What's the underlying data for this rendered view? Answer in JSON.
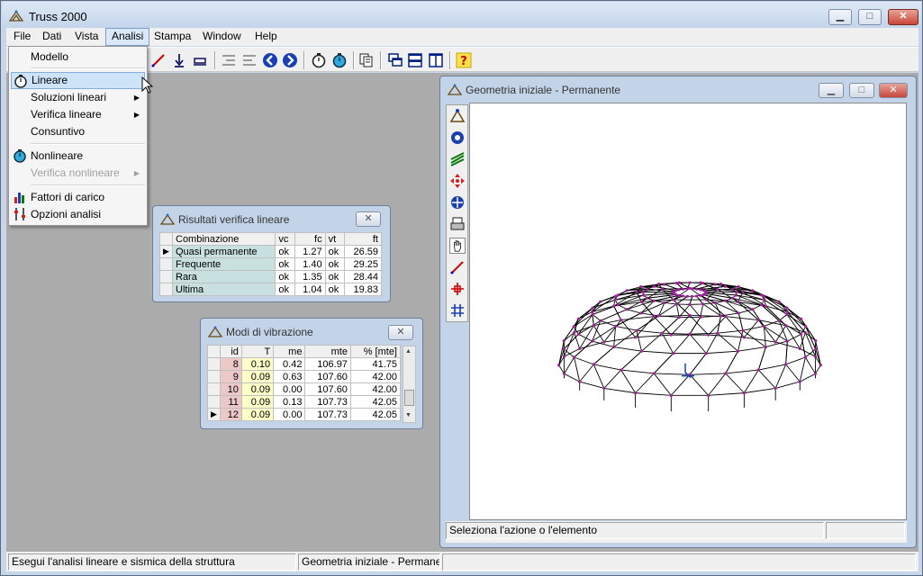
{
  "window": {
    "title": "Truss 2000",
    "min": "▁",
    "max": "□",
    "close": "✕"
  },
  "menu": [
    "File",
    "Dati",
    "Vista",
    "Analisi",
    "Stampa",
    "Window",
    "Help"
  ],
  "dropdown": {
    "items": [
      {
        "label": "Modello"
      },
      {
        "label": "Lineare"
      },
      {
        "label": "Soluzioni lineari"
      },
      {
        "label": "Verifica lineare"
      },
      {
        "label": "Consuntivo"
      },
      {
        "label": "Nonlineare"
      },
      {
        "label": "Verifica nonlineare"
      },
      {
        "label": "Fattori di carico"
      },
      {
        "label": "Opzioni analisi"
      }
    ],
    "arrow": "▶"
  },
  "verifica": {
    "title": "Risultati verifica lineare",
    "close": "✕",
    "headers": [
      "Combinazione",
      "vc",
      "fc",
      "vt",
      "ft"
    ],
    "rows": [
      {
        "name": "Quasi permanente",
        "vc": "ok",
        "fc": "1.27",
        "vt": "ok",
        "ft": "26.59"
      },
      {
        "name": "Frequente",
        "vc": "ok",
        "fc": "1.40",
        "vt": "ok",
        "ft": "29.25"
      },
      {
        "name": "Rara",
        "vc": "ok",
        "fc": "1.35",
        "vt": "ok",
        "ft": "28.44"
      },
      {
        "name": "Ultima",
        "vc": "ok",
        "fc": "1.04",
        "vt": "ok",
        "ft": "19.83"
      }
    ]
  },
  "modi": {
    "title": "Modi di vibrazione",
    "close": "✕",
    "headers": [
      "id",
      "T",
      "me",
      "mte",
      "% [mte]"
    ],
    "rows": [
      {
        "id": "8",
        "T": "0.10",
        "me": "0.42",
        "mte": "106.97",
        "p": "41.75"
      },
      {
        "id": "9",
        "T": "0.09",
        "me": "0.63",
        "mte": "107.60",
        "p": "42.00"
      },
      {
        "id": "10",
        "T": "0.09",
        "me": "0.00",
        "mte": "107.60",
        "p": "42.00"
      },
      {
        "id": "11",
        "T": "0.09",
        "me": "0.13",
        "mte": "107.73",
        "p": "42.05"
      },
      {
        "id": "12",
        "T": "0.09",
        "me": "0.00",
        "mte": "107.73",
        "p": "42.05"
      }
    ]
  },
  "geometry": {
    "title": "Geometria iniziale - Permanente",
    "status": "Seleziona l'azione o l'elemento",
    "min": "▁",
    "max": "□",
    "close": "✕"
  },
  "statusbar": {
    "hint": "Esegui l'analisi lineare e sismica della struttura",
    "window": "Geometria iniziale - Permanente"
  },
  "colors": {
    "accent": "#3399ff",
    "node": "#a0209a",
    "member": "#000000"
  }
}
